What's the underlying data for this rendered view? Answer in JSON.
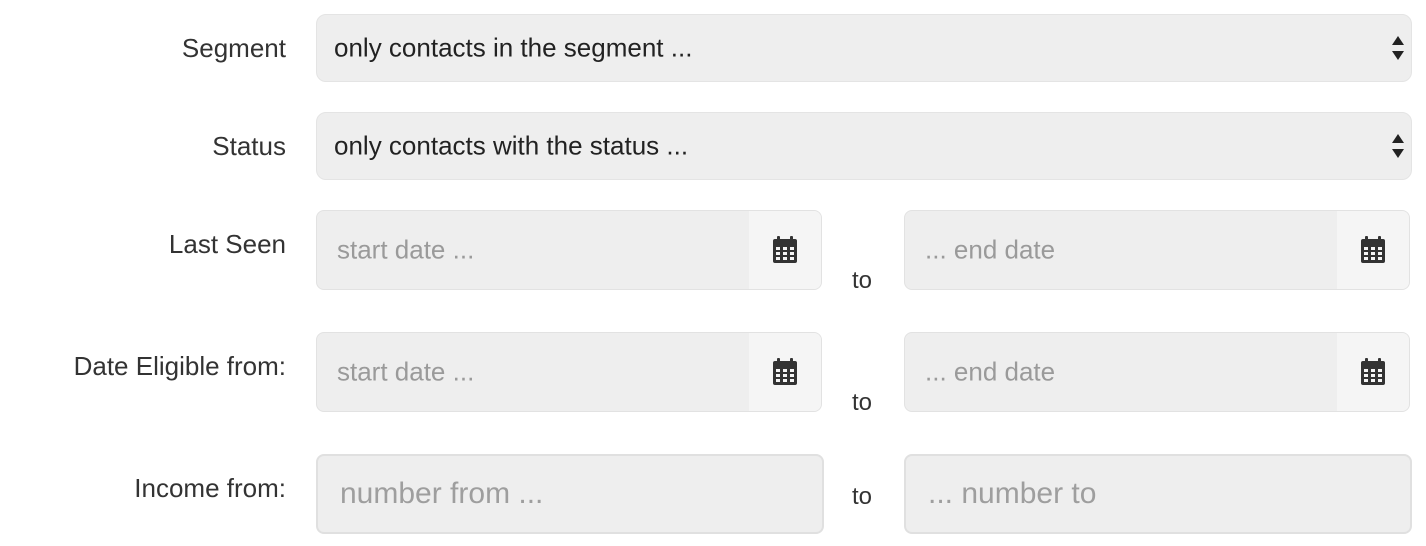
{
  "segment": {
    "label": "Segment",
    "value": "only contacts in the segment ..."
  },
  "status": {
    "label": "Status",
    "value": "only contacts with the status ..."
  },
  "last_seen": {
    "label": "Last Seen",
    "start_placeholder": "start date ...",
    "separator": "to",
    "end_placeholder": "... end date"
  },
  "date_eligible": {
    "label": "Date Eligible from:",
    "start_placeholder": "start date ...",
    "separator": "to",
    "end_placeholder": "... end date"
  },
  "income": {
    "label": "Income from:",
    "from_placeholder": "number from ...",
    "separator": "to",
    "to_placeholder": "... number to"
  },
  "icons": {
    "select_arrows": "up-down-arrows-icon",
    "calendar": "calendar-icon"
  }
}
